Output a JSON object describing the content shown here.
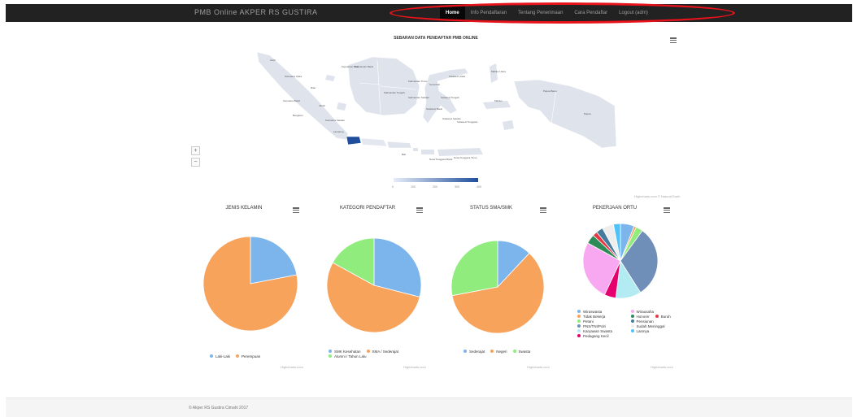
{
  "nav": {
    "brand": "PMB Online AKPER RS GUSTIRA",
    "items": [
      {
        "label": "Home",
        "active": true
      },
      {
        "label": "Info Pendaftaran",
        "active": false
      },
      {
        "label": "Tentang Penerimaan",
        "active": false
      },
      {
        "label": "Cara Pendaftar",
        "active": false
      },
      {
        "label": "Logout (adm)",
        "active": false
      }
    ]
  },
  "map": {
    "title": "SEBARAN DATA PENDAFTAR PMB ONLINE",
    "zoom_in": "+",
    "zoom_out": "−",
    "credits": "Highcharts.com © Natural Earth",
    "scale_ticks": [
      "0",
      "100",
      "200",
      "300",
      "400"
    ],
    "provinces": [
      "Aceh",
      "Sumatera Utara",
      "Riau",
      "Sumatera Barat",
      "Jambi",
      "Bengkulu",
      "Sumatera Selatan",
      "Lampung",
      "Kepulauan Riau",
      "Kalimantan Barat",
      "Kalimantan Tengah",
      "Kalimantan Selatan",
      "Kalimantan Timur",
      "Sulawesi Utara",
      "Gorontalo",
      "Sulawesi Tengah",
      "Sulawesi Barat",
      "Sulawesi Selatan",
      "Sulawesi Tenggara",
      "Maluku Utara",
      "Maluku",
      "Papua Barat",
      "Papua",
      "Bali",
      "Nusa Tenggara Barat",
      "Nusa Tenggara Timur"
    ],
    "colors": {
      "land": "#dfe3ec",
      "highlight": "#1f4f9c",
      "scale_low": "#e6edf8",
      "scale_high": "#1f4f9c"
    }
  },
  "charts": [
    {
      "title": "JENIS KELAMIN",
      "type": "pie",
      "slices": [
        {
          "name": "Laki-Laki",
          "value": 22,
          "color": "#7cb5ec"
        },
        {
          "name": "Perempuan",
          "value": 78,
          "color": "#f7a35c"
        }
      ],
      "credits": "Highcharts.com"
    },
    {
      "title": "KATEGORI PENDAFTAR",
      "type": "pie",
      "slices": [
        {
          "name": "SMK Kesehatan",
          "value": 29,
          "color": "#7cb5ec"
        },
        {
          "name": "SMA / Sederajat",
          "value": 54,
          "color": "#f7a35c"
        },
        {
          "name": "Alumni / Tahun Lalu",
          "value": 17,
          "color": "#90ed7d"
        }
      ],
      "credits": "Highcharts.com"
    },
    {
      "title": "STATUS SMA/SMK",
      "type": "pie",
      "slices": [
        {
          "name": "Sederajat",
          "value": 12,
          "color": "#7cb5ec"
        },
        {
          "name": "Negeri",
          "value": 60,
          "color": "#f7a35c"
        },
        {
          "name": "Swasta",
          "value": 28,
          "color": "#90ed7d"
        }
      ],
      "credits": "Highcharts.com"
    },
    {
      "title": "PEKERJAAN ORTU",
      "type": "pie",
      "slices": [
        {
          "name": "Wiraswasta",
          "value": 6,
          "color": "#7cb5ec"
        },
        {
          "name": "Tidak Bekerja",
          "value": 1,
          "color": "#f7a35c"
        },
        {
          "name": "Petani",
          "value": 3,
          "color": "#90ed7d"
        },
        {
          "name": "PNS/TNI/Polri",
          "value": 31,
          "color": "#6f8fb9"
        },
        {
          "name": "Karyawan Swasta",
          "value": 11,
          "color": "#b2ebf2"
        },
        {
          "name": "Pedagang Kecil",
          "value": 5,
          "color": "#e5006e"
        },
        {
          "name": "Wirausaha",
          "value": 26,
          "color": "#f7a8f0"
        },
        {
          "name": "Honorer",
          "value": 4,
          "color": "#2e8b57"
        },
        {
          "name": "Buruh",
          "value": 2,
          "color": "#e63946"
        },
        {
          "name": "Pensiunan",
          "value": 3,
          "color": "#457b9d"
        },
        {
          "name": "Sudah Meninggal",
          "value": 5,
          "color": "#eeeeee"
        },
        {
          "name": "Lainnya",
          "value": 3,
          "color": "#4fc3f7"
        }
      ],
      "credits": "Highcharts.com"
    }
  ],
  "footer": {
    "text": "© Akper RS Gustira Cimahi 2017"
  }
}
